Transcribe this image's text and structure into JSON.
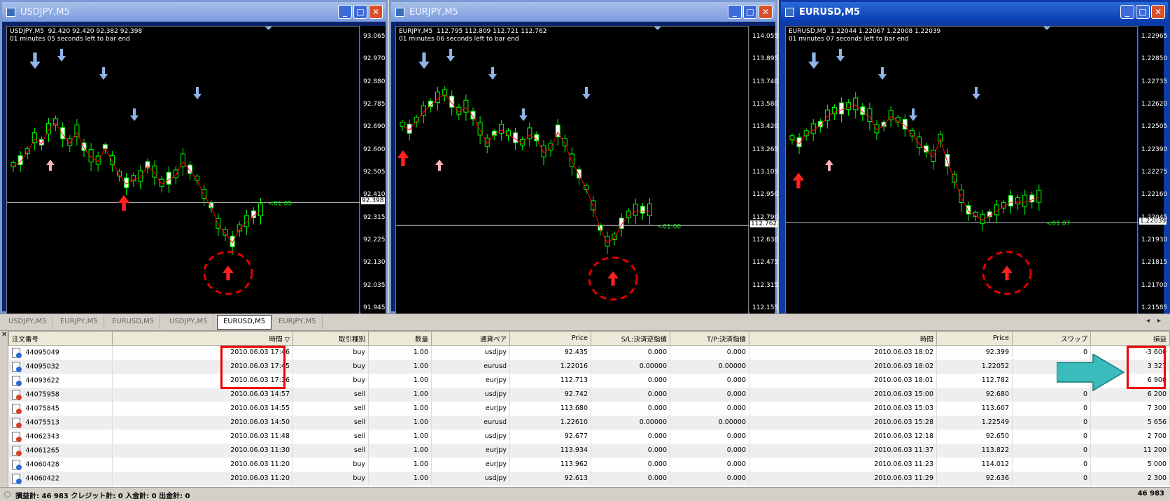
{
  "windows": [
    {
      "id": "w1",
      "title": "USDJPY,M5",
      "info_line1": "USDJPY,M5  92.420 92.420 92.382 92.398",
      "info_line2": "01 minutes 05 seconds left to bar end",
      "timer": "<01:05",
      "current_price": "92.398",
      "ticks": [
        "93.065",
        "92.970",
        "92.880",
        "92.785",
        "92.690",
        "92.600",
        "92.505",
        "92.410",
        "92.315",
        "92.225",
        "92.130",
        "92.035",
        "91.945"
      ],
      "ymax": 93.065,
      "ymin": 91.945
    },
    {
      "id": "w2",
      "title": "EURJPY,M5",
      "info_line1": "EURJPY,M5  112.795 112.809 112.721 112.762",
      "info_line2": "01 minutes 06 seconds left to bar end",
      "timer": "<01:06",
      "current_price": "112.762",
      "ticks": [
        "114.055",
        "113.895",
        "113.740",
        "113.580",
        "113.420",
        "113.265",
        "113.105",
        "112.950",
        "112.790",
        "112.630",
        "112.475",
        "112.315",
        "112.155"
      ],
      "ymax": 114.055,
      "ymin": 112.155
    },
    {
      "id": "w3",
      "title": "EURUSD,M5",
      "info_line1": "EURUSD,M5  1.22044 1.22067 1.22008 1.22039",
      "info_line2": "01 minutes 07 seconds left to bar end",
      "timer": "<01:07",
      "current_price": "1.22039",
      "ticks": [
        "1.22965",
        "1.22850",
        "1.22735",
        "1.22620",
        "1.22505",
        "1.22390",
        "1.22275",
        "1.22160",
        "1.22045",
        "1.21930",
        "1.21815",
        "1.21700",
        "1.21585"
      ],
      "ymax": 1.22965,
      "ymin": 1.21585
    }
  ],
  "tabs": [
    "USDJPY,M5",
    "EURJPY,M5",
    "EURUSD,M5",
    "USDJPY,M5",
    "EURUSD,M5",
    "EURJPY,M5"
  ],
  "active_tab": 4,
  "table": {
    "headers": [
      "注文番号",
      "時間",
      "取引種別",
      "数量",
      "通貨ペア",
      "Price",
      "S/L:決済逆指値",
      "T/P:決済指値",
      "時間",
      "Price",
      "スワップ",
      "損益"
    ],
    "rows": [
      [
        "44095049",
        "2010.06.03 17:46",
        "buy",
        "1.00",
        "usdjpy",
        "92.435",
        "0.000",
        "0.000",
        "2010.06.03 18:02",
        "92.399",
        "0",
        "-3 600"
      ],
      [
        "44095032",
        "2010.06.03 17:45",
        "buy",
        "1.00",
        "eurusd",
        "1.22016",
        "0.00000",
        "0.00000",
        "2010.06.03 18:02",
        "1.22052",
        "0",
        "3 327"
      ],
      [
        "44093622",
        "2010.06.03 17:36",
        "buy",
        "1.00",
        "eurjpy",
        "112.713",
        "0.000",
        "0.000",
        "2010.06.03 18:01",
        "112.782",
        "0",
        "6 900"
      ],
      [
        "44075958",
        "2010.06.03 14:57",
        "sell",
        "1.00",
        "usdjpy",
        "92.742",
        "0.000",
        "0.000",
        "2010.06.03 15:00",
        "92.680",
        "0",
        "6 200"
      ],
      [
        "44075845",
        "2010.06.03 14:55",
        "sell",
        "1.00",
        "eurjpy",
        "113.680",
        "0.000",
        "0.000",
        "2010.06.03 15:03",
        "113.607",
        "0",
        "7 300"
      ],
      [
        "44075513",
        "2010.06.03 14:50",
        "sell",
        "1.00",
        "eurusd",
        "1.22610",
        "0.00000",
        "0.00000",
        "2010.06.03 15:28",
        "1.22549",
        "0",
        "5 656"
      ],
      [
        "44062343",
        "2010.06.03 11:48",
        "sell",
        "1.00",
        "usdjpy",
        "92.677",
        "0.000",
        "0.000",
        "2010.06.03 12:18",
        "92.650",
        "0",
        "2 700"
      ],
      [
        "44061265",
        "2010.06.03 11:30",
        "sell",
        "1.00",
        "eurjpy",
        "113.934",
        "0.000",
        "0.000",
        "2010.06.03 11:37",
        "113.822",
        "0",
        "11 200"
      ],
      [
        "44060428",
        "2010.06.03 11:20",
        "buy",
        "1.00",
        "eurjpy",
        "113.962",
        "0.000",
        "0.000",
        "2010.06.03 11:23",
        "114.012",
        "0",
        "5 000"
      ],
      [
        "44060422",
        "2010.06.03 11:20",
        "buy",
        "1.00",
        "usdjpy",
        "92.613",
        "0.000",
        "0.000",
        "2010.06.03 11:29",
        "92.636",
        "0",
        "2 300"
      ]
    ]
  },
  "status": {
    "summary": "損益計: 46 983  クレジット計: 0  入金計: 0  出金計: 0",
    "total": "46 983"
  },
  "colors": {
    "bull": "#00ff00",
    "ma": "#ff0000",
    "buy_icon": "#2a6ad8",
    "sell_icon": "#d8402a",
    "highlight": "#e00000",
    "arrow": "#3bbcbc"
  }
}
